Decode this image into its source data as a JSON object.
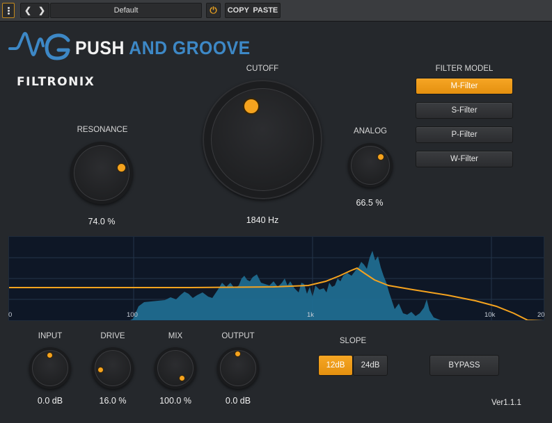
{
  "host_toolbar": {
    "menu_icon": "kebab-menu-icon",
    "prev_icon": "chevron-left-icon",
    "next_icon": "chevron-right-icon",
    "preset_name": "Default",
    "power_icon": "power-icon",
    "copy_label": "COPY",
    "paste_label": "PASTE"
  },
  "brand": {
    "logo_icon": "push-and-groove-logo",
    "word1": "PUSH",
    "word2": "AND GROOVE",
    "product": "FILTRONIX"
  },
  "knobs": {
    "resonance": {
      "label": "RESONANCE",
      "value": "74.0 %"
    },
    "cutoff": {
      "label": "CUTOFF",
      "value": "1840 Hz"
    },
    "analog": {
      "label": "ANALOG",
      "value": "66.5 %"
    },
    "input": {
      "label": "INPUT",
      "value": "0.0 dB"
    },
    "drive": {
      "label": "DRIVE",
      "value": "16.0 %"
    },
    "mix": {
      "label": "MIX",
      "value": "100.0 %"
    },
    "output": {
      "label": "OUTPUT",
      "value": "0.0 dB"
    }
  },
  "filter_model": {
    "label": "FILTER MODEL",
    "options": [
      "M-Filter",
      "S-Filter",
      "P-Filter",
      "W-Filter"
    ],
    "selected": "M-Filter"
  },
  "analyzer": {
    "freq_labels": [
      "0",
      "100",
      "1k",
      "10k",
      "20"
    ]
  },
  "slope": {
    "label": "SLOPE",
    "options": [
      "12dB",
      "24dB"
    ],
    "selected": "12dB"
  },
  "bypass_label": "BYPASS",
  "version": "Ver1.1.1",
  "colors": {
    "accent": "#f5a31e",
    "brand_blue": "#3d88c6",
    "background": "#25282c",
    "analyzer_bg": "#0e1726",
    "spectrum": "#1f6f93"
  }
}
